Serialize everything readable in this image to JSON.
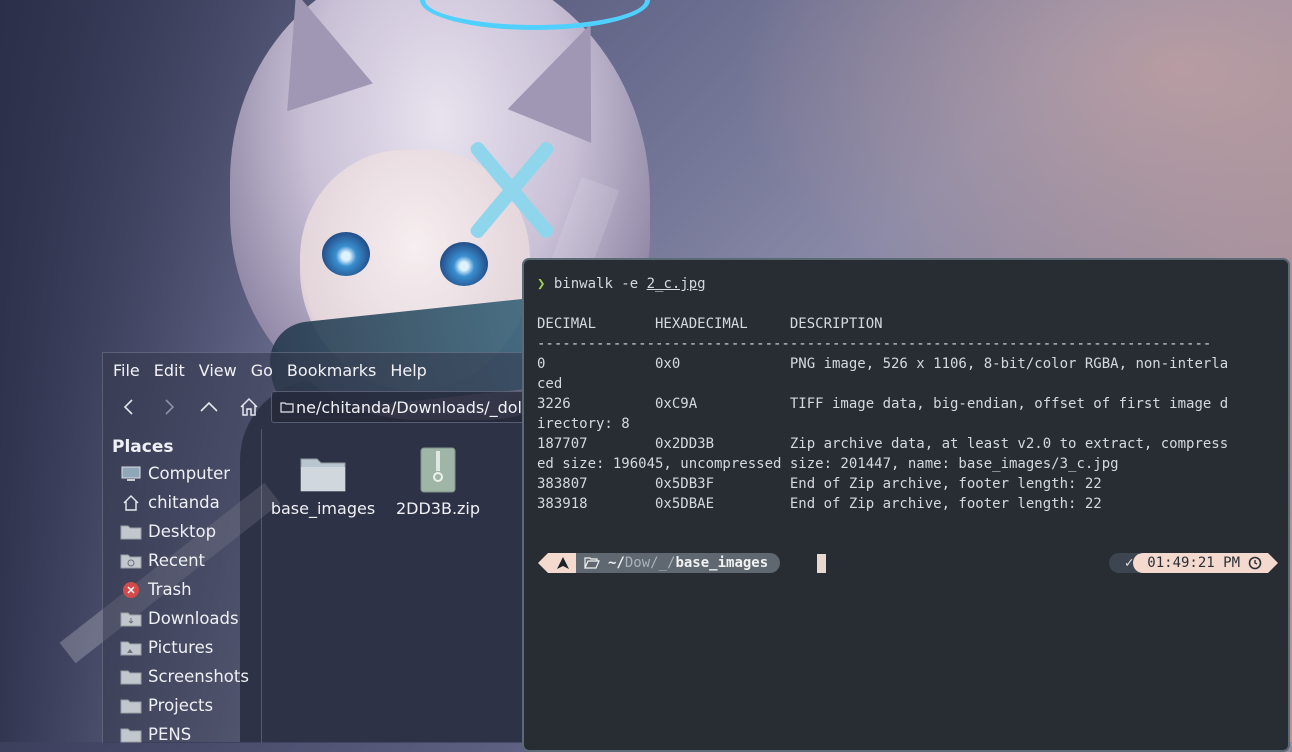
{
  "file_manager": {
    "menu": [
      "File",
      "Edit",
      "View",
      "Go",
      "Bookmarks",
      "Help"
    ],
    "location_text": "ne/chitanda/Downloads/_dolls",
    "places_header": "Places",
    "places": [
      {
        "label": "Computer",
        "icon": "computer-icon"
      },
      {
        "label": "chitanda",
        "icon": "home-icon"
      },
      {
        "label": "Desktop",
        "icon": "folder-icon"
      },
      {
        "label": "Recent",
        "icon": "recent-folder-icon"
      },
      {
        "label": "Trash",
        "icon": "trash-icon"
      },
      {
        "label": "Downloads",
        "icon": "downloads-folder-icon"
      },
      {
        "label": "Pictures",
        "icon": "pictures-folder-icon"
      },
      {
        "label": "Screenshots",
        "icon": "folder-icon"
      },
      {
        "label": "Projects",
        "icon": "folder-icon"
      },
      {
        "label": "PENS",
        "icon": "folder-icon"
      }
    ],
    "files": [
      {
        "name": "base_images",
        "icon": "folder-icon"
      },
      {
        "name": "2DD3B.zip",
        "icon": "zip-archive-icon"
      }
    ]
  },
  "terminal": {
    "prompt_symbol": "❯",
    "command": "binwalk -e ",
    "command_arg": "2_c.jpg",
    "table_header": "DECIMAL       HEXADECIMAL     DESCRIPTION",
    "separator": "--------------------------------------------------------------------------------",
    "rows_text": "0             0x0             PNG image, 526 x 1106, 8-bit/color RGBA, non-interla\nced\n3226          0xC9A           TIFF image data, big-endian, offset of first image d\nirectory: 8\n187707        0x2DD3B         Zip archive data, at least v2.0 to extract, compress\ned size: 196045, uncompressed size: 201447, name: base_images/3_c.jpg\n383807        0x5DB3F         End of Zip archive, footer length: 22\n383918        0x5DBAE         End of Zip archive, footer length: 22",
    "rows": [
      {
        "decimal": "0",
        "hex": "0x0",
        "description": "PNG image, 526 x 1106, 8-bit/color RGBA, non-interlaced"
      },
      {
        "decimal": "3226",
        "hex": "0xC9A",
        "description": "TIFF image data, big-endian, offset of first image directory: 8"
      },
      {
        "decimal": "187707",
        "hex": "0x2DD3B",
        "description": "Zip archive data, at least v2.0 to extract, compressed size: 196045, uncompressed size: 201447, name: base_images/3_c.jpg"
      },
      {
        "decimal": "383807",
        "hex": "0x5DB3F",
        "description": "End of Zip archive, footer length: 22"
      },
      {
        "decimal": "383918",
        "hex": "0x5DBAE",
        "description": "End of Zip archive, footer length: 22"
      }
    ],
    "powerline": {
      "os_icon": "arch-icon",
      "path_prefix": "~/",
      "path_dim": "Dow",
      "path_mid": "/_/",
      "path_last": "base_images",
      "status": "✓",
      "time": "01:49:21 PM",
      "clock_icon": "clock-icon"
    }
  },
  "colors": {
    "terminal_bg": "#272d32",
    "prompt_green": "#a3d04a",
    "powerline_peach": "#f4d9cf"
  }
}
